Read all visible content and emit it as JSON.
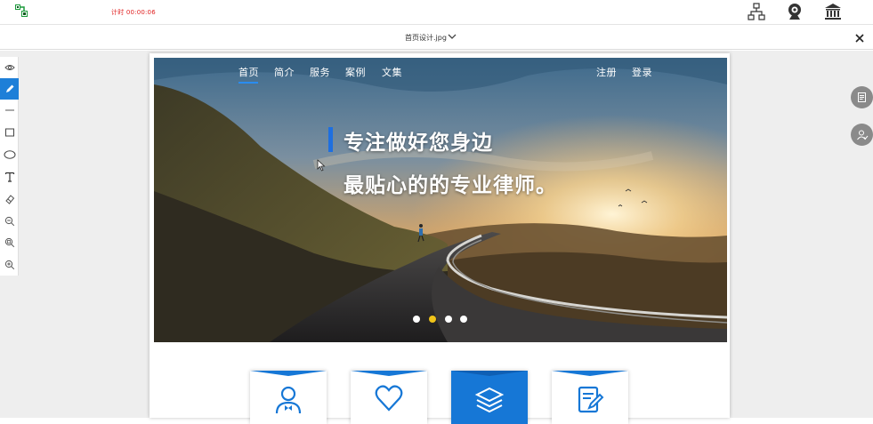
{
  "topbar": {
    "timer": "计时 00:00:06",
    "icons": [
      "app-logo-icon",
      "sitemap-icon",
      "webcam-icon",
      "bank-icon"
    ]
  },
  "file": {
    "name": "首页设计.jpg"
  },
  "tools": [
    "eye-icon",
    "pencil-icon",
    "line-icon",
    "rectangle-icon",
    "ellipse-icon",
    "text-icon",
    "eraser-icon",
    "zoom-out-icon",
    "zoom-reset-icon",
    "zoom-in-icon"
  ],
  "hero": {
    "nav": [
      "首页",
      "简介",
      "服务",
      "案例",
      "文集"
    ],
    "auth": [
      "注册",
      "登录"
    ],
    "headline_line1": "专注做好您身边",
    "headline_line2": "最贴心的的专业律师。",
    "carousel": {
      "count": 4,
      "active_index": 1
    }
  },
  "cards": [
    {
      "icon": "user-tie-icon",
      "active": false
    },
    {
      "icon": "heart-icon",
      "active": false
    },
    {
      "icon": "layers-icon",
      "active": true
    },
    {
      "icon": "document-edit-icon",
      "active": false
    }
  ],
  "colors": {
    "accent_blue": "#1677d6",
    "timer_red": "#e02020",
    "dot_active": "#f0c419",
    "tool_active": "#1e7fd8"
  }
}
